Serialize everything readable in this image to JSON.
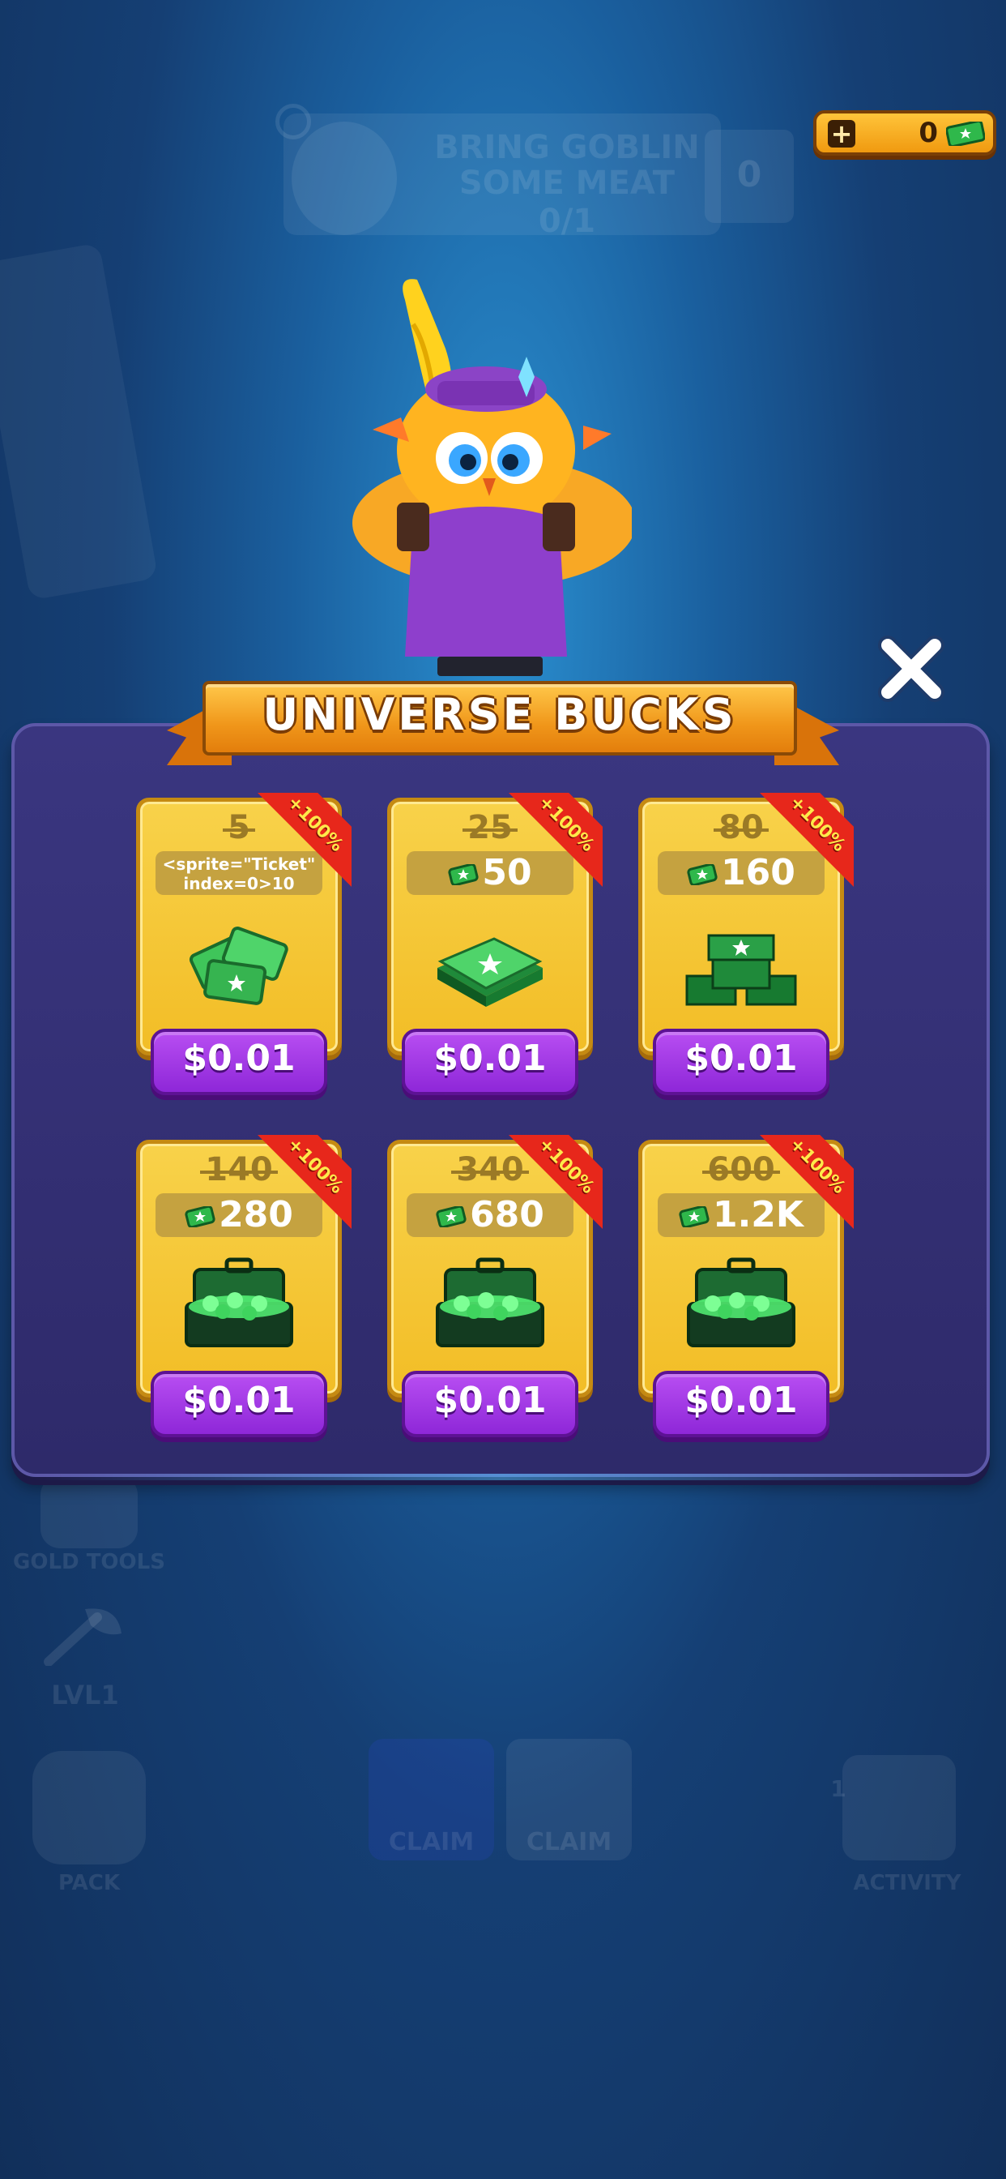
{
  "hud": {
    "currency_value": "0",
    "quest_title": "BRING GOBLIN SOME MEAT",
    "quest_progress": "0/1",
    "quest_side_value": "0"
  },
  "background_menu": {
    "gold_tools": "GOLD TOOLS",
    "level": "LVL1",
    "pack": "PACK",
    "claim_1": "CLAIM",
    "claim_2": "CLAIM",
    "activity": "ACTIVITY",
    "activity_badge": "1"
  },
  "shop": {
    "title": "UNIVERSE BUCKS",
    "close_icon": "close-icon",
    "cards": [
      {
        "old_amount": "5",
        "amount": "<sprite=\"Ticket\" index=0>10",
        "price": "$0.01",
        "badge": "+100%",
        "image": "bucks-scatter"
      },
      {
        "old_amount": "25",
        "amount": "50",
        "price": "$0.01",
        "badge": "+100%",
        "image": "bucks-stack-small"
      },
      {
        "old_amount": "80",
        "amount": "160",
        "price": "$0.01",
        "badge": "+100%",
        "image": "bucks-stack-large"
      },
      {
        "old_amount": "140",
        "amount": "280",
        "price": "$0.01",
        "badge": "+100%",
        "image": "bucks-briefcase"
      },
      {
        "old_amount": "340",
        "amount": "680",
        "price": "$0.01",
        "badge": "+100%",
        "image": "bucks-briefcase"
      },
      {
        "old_amount": "600",
        "amount": "1.2K",
        "price": "$0.01",
        "badge": "+100%",
        "image": "bucks-briefcase"
      }
    ]
  },
  "colors": {
    "panel": "#3a3680",
    "card": "#f8d24a",
    "price_button": "#9b33e2",
    "badge": "#e7271b",
    "ribbon": "#f0961a"
  }
}
